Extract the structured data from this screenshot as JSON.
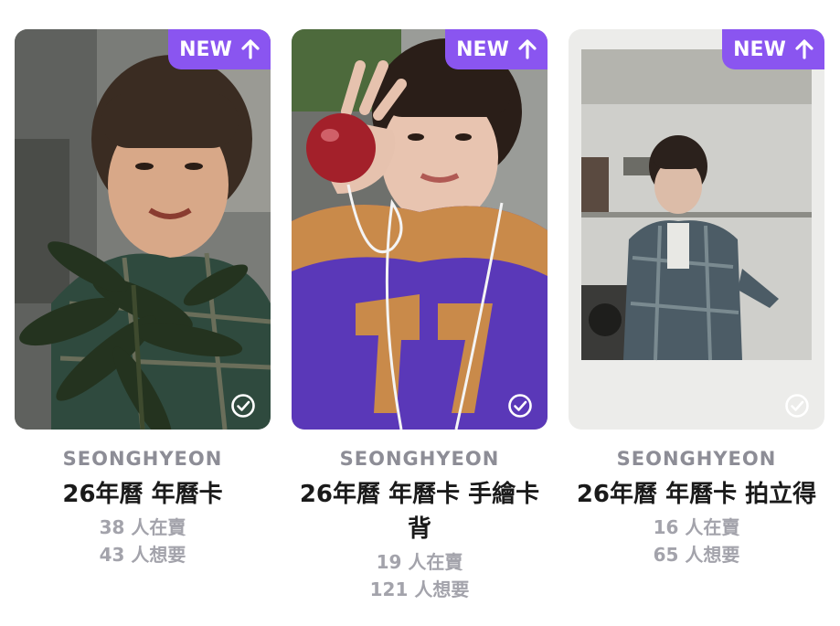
{
  "colors": {
    "badge": "#8a55f0",
    "artist_text": "#8d8d96",
    "title_text": "#1a1a1a",
    "stat_text": "#a3a3ab"
  },
  "cards": [
    {
      "badge": "NEW",
      "badge_icon": "arrow-up-icon",
      "status_icon": "check-circle-icon",
      "artist": "SEONGHYEON",
      "title": "26年曆 年曆卡",
      "selling": "38 人在賣",
      "wanting": "43 人想要"
    },
    {
      "badge": "NEW",
      "badge_icon": "arrow-up-icon",
      "status_icon": "check-circle-icon",
      "artist": "SEONGHYEON",
      "title": "26年曆 年曆卡 手繪卡背",
      "selling": "19 人在賣",
      "wanting": "121 人想要"
    },
    {
      "badge": "NEW",
      "badge_icon": "arrow-up-icon",
      "status_icon": "check-circle-icon",
      "artist": "SEONGHYEON",
      "title": "26年曆 年曆卡 拍立得",
      "selling": "16 人在賣",
      "wanting": "65 人想要"
    }
  ]
}
